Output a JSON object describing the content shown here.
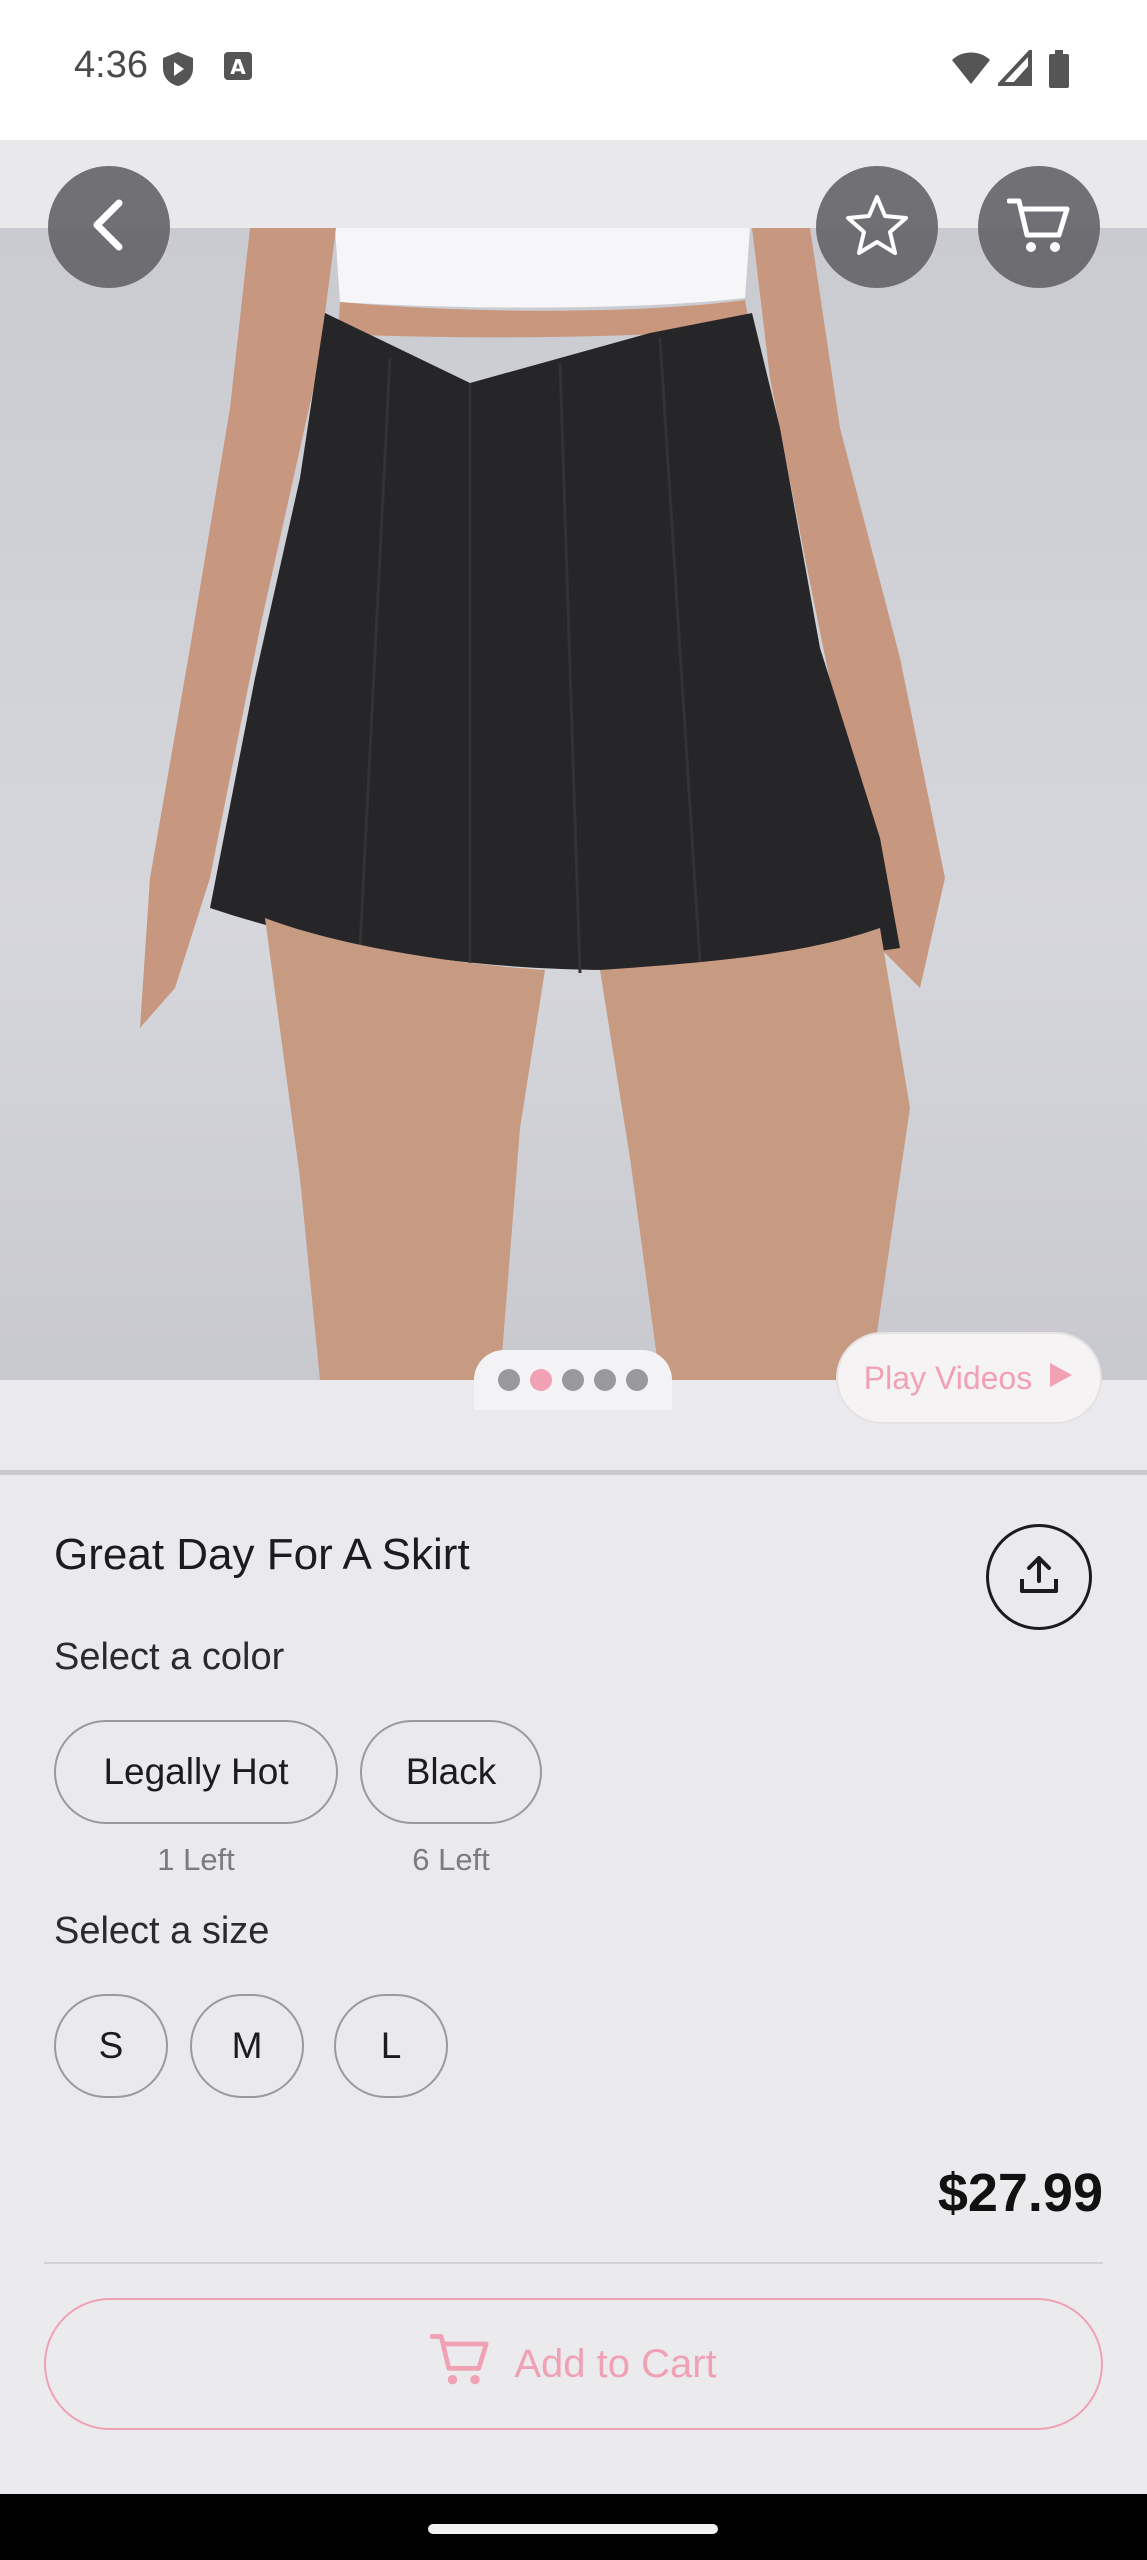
{
  "status_bar": {
    "time": "4:36",
    "icons": [
      "shield-icon",
      "a-icon",
      "wifi-icon",
      "signal-icon",
      "battery-icon"
    ]
  },
  "header": {
    "back_icon": "chevron-left-icon",
    "favorite_icon": "star-icon",
    "cart_icon": "cart-icon"
  },
  "gallery": {
    "image_count": 5,
    "active_index": 1,
    "play_videos_label": "Play Videos"
  },
  "product": {
    "title": "Great Day For A Skirt",
    "color_label": "Select a color",
    "colors": [
      {
        "name": "Legally Hot",
        "stock": "1 Left"
      },
      {
        "name": "Black",
        "stock": "6 Left"
      }
    ],
    "size_label": "Select a size",
    "sizes": [
      "S",
      "M",
      "L"
    ]
  },
  "purchase": {
    "price": "$27.99",
    "add_to_cart_label": "Add to Cart"
  },
  "colors": {
    "accent_pink": "#f0a1b4",
    "text_dark": "#1c1c1e",
    "background": "#eaeaee"
  }
}
